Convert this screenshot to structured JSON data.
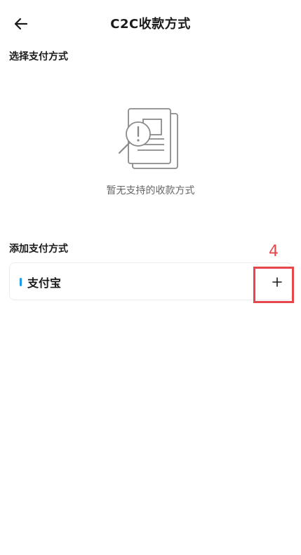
{
  "header": {
    "title": "C2C收款方式",
    "back_icon": "arrow-left-icon"
  },
  "select_section": {
    "label": "选择支付方式",
    "empty_state": {
      "icon": "document-search-alert-icon",
      "text": "暂无支持的收款方式"
    }
  },
  "add_section": {
    "label": "添加支付方式",
    "methods": [
      {
        "name": "支付宝",
        "accent_color": "#1e9be8",
        "action_icon": "plus-icon"
      }
    ]
  },
  "annotation": {
    "number": "4",
    "color": "#e5474a"
  }
}
